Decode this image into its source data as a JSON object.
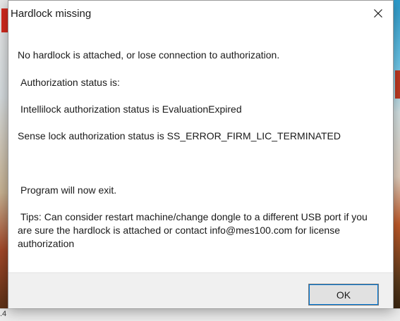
{
  "dialog": {
    "title": "Hardlock missing",
    "close_icon": "close-icon",
    "messages": {
      "line1": "No hardlock is attached, or lose connection to authorization.",
      "line2": "Authorization status is:",
      "line3": "Intellilock authorization status is EvaluationExpired",
      "line4": "Sense lock authorization status is SS_ERROR_FIRM_LIC_TERMINATED",
      "line5": "Program will now exit.",
      "tips": "Tips: Can consider restart machine/change dongle to a different USB port if you are sure the hardlock is attached or contact info@mes100.com for license authorization"
    },
    "ok_label": "OK"
  },
  "background": {
    "bottom_text": ".4"
  },
  "colors": {
    "focus_outline": "#0078d7",
    "button_face": "#e1e1e1",
    "footer": "#f0f0f0"
  }
}
